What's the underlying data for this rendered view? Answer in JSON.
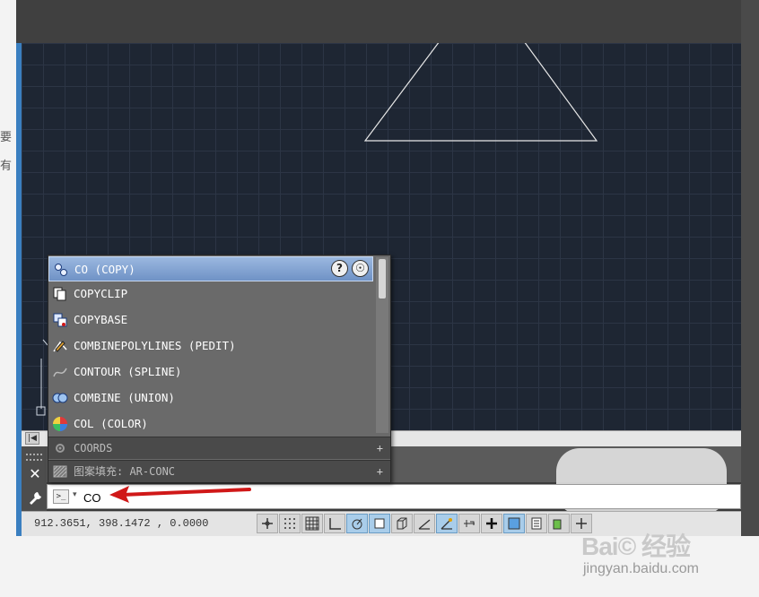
{
  "page": {
    "left_chars": [
      "要",
      "有"
    ]
  },
  "autocomplete": {
    "selected": {
      "label": "CO (COPY)",
      "icon": "copy-icon"
    },
    "items": [
      {
        "label": "COPYCLIP",
        "icon": "copyclip-icon"
      },
      {
        "label": "COPYBASE",
        "icon": "copybase-icon"
      },
      {
        "label": "COMBINEPOLYLINES (PEDIT)",
        "icon": "pedit-icon"
      },
      {
        "label": "CONTOUR (SPLINE)",
        "icon": "spline-icon"
      },
      {
        "label": "COMBINE (UNION)",
        "icon": "union-icon"
      },
      {
        "label": "COL (COLOR)",
        "icon": "color-wheel-icon"
      }
    ],
    "groups": [
      {
        "label": "COORDS",
        "icon": "gear-icon"
      },
      {
        "label": "图案填充: AR-CONC",
        "icon": "hatch-icon"
      }
    ],
    "help_glyph": "?",
    "online_glyph": "☉"
  },
  "command_line": {
    "value": "CO",
    "prompt_glyph": ">_",
    "dropdown_glyph": "▾"
  },
  "left_tools": {
    "close_glyph": "✕"
  },
  "status": {
    "coordinates": "912.3651,  398.1472 , 0.0000"
  },
  "watermark": {
    "logo": "Bai© 经验",
    "url": "jingyan.baidu.com"
  },
  "colors": {
    "viewport_bg": "#1e2633",
    "selection": "#7b9ccf",
    "arrow": "#d01818"
  }
}
